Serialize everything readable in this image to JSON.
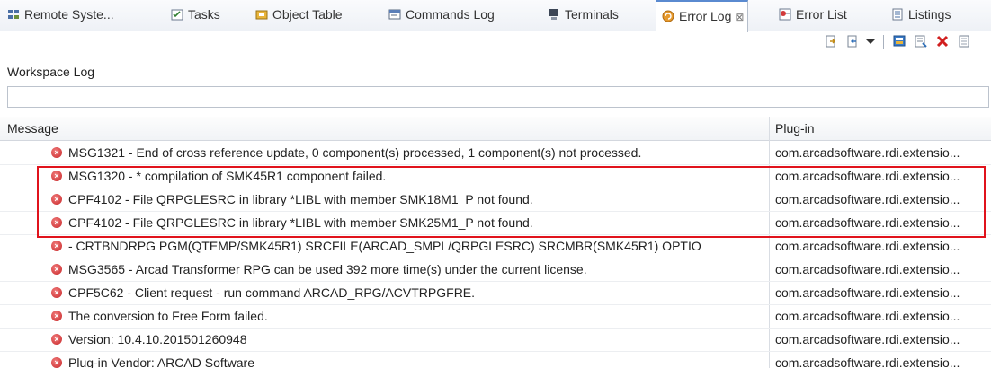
{
  "tabs": [
    {
      "label": "Remote Syste...",
      "icon": "remote-systems-icon",
      "active": false
    },
    {
      "label": "Tasks",
      "icon": "tasks-icon",
      "active": false
    },
    {
      "label": "Object Table",
      "icon": "object-table-icon",
      "active": false
    },
    {
      "label": "Commands Log",
      "icon": "commands-log-icon",
      "active": false
    },
    {
      "label": "Terminals",
      "icon": "terminals-icon",
      "active": false
    },
    {
      "label": "Error Log",
      "icon": "error-log-icon",
      "active": true,
      "close": "⊠"
    },
    {
      "label": "Error List",
      "icon": "error-list-icon",
      "active": false
    },
    {
      "label": "Listings",
      "icon": "listings-icon",
      "active": false
    }
  ],
  "toolbar_icons": [
    "export-log-icon",
    "import-log-icon",
    "view-menu-chevron-icon",
    "open-log-icon",
    "restore-log-icon",
    "delete-log-icon",
    "clear-log-icon"
  ],
  "workspace_log_label": "Workspace Log",
  "filter": {
    "value": "",
    "placeholder": ""
  },
  "table": {
    "headers": {
      "message": "Message",
      "plugin": "Plug-in"
    },
    "rows": [
      {
        "message": "MSG1321 - End of cross reference update, 0 component(s) processed, 1 component(s) not processed.",
        "plugin": "com.arcadsoftware.rdi.extensio..."
      },
      {
        "message": "MSG1320 - * compilation of SMK45R1 component failed.",
        "plugin": "com.arcadsoftware.rdi.extensio..."
      },
      {
        "message": "CPF4102 - File QRPGLESRC in library *LIBL with member SMK18M1_P not found.",
        "plugin": "com.arcadsoftware.rdi.extensio..."
      },
      {
        "message": "CPF4102 - File QRPGLESRC in library *LIBL with member SMK25M1_P not found.",
        "plugin": "com.arcadsoftware.rdi.extensio..."
      },
      {
        "message": " - CRTBNDRPG PGM(QTEMP/SMK45R1) SRCFILE(ARCAD_SMPL/QRPGLESRC) SRCMBR(SMK45R1) OPTIO",
        "plugin": "com.arcadsoftware.rdi.extensio..."
      },
      {
        "message": "MSG3565 - Arcad Transformer RPG can be used 392 more time(s) under the current license.",
        "plugin": "com.arcadsoftware.rdi.extensio..."
      },
      {
        "message": "CPF5C62 - Client request - run command ARCAD_RPG/ACVTRPGFRE.",
        "plugin": "com.arcadsoftware.rdi.extensio..."
      },
      {
        "message": "The conversion to Free Form failed.",
        "plugin": "com.arcadsoftware.rdi.extensio..."
      },
      {
        "message": "Version: 10.4.10.201501260948",
        "plugin": "com.arcadsoftware.rdi.extensio..."
      },
      {
        "message": "Plug-in Vendor: ARCAD Software",
        "plugin": "com.arcadsoftware.rdi.extensio..."
      }
    ]
  },
  "colors": {
    "highlight": "#e0131c",
    "error": "#c8282a",
    "active_tab_border": "#5a8ad0"
  }
}
